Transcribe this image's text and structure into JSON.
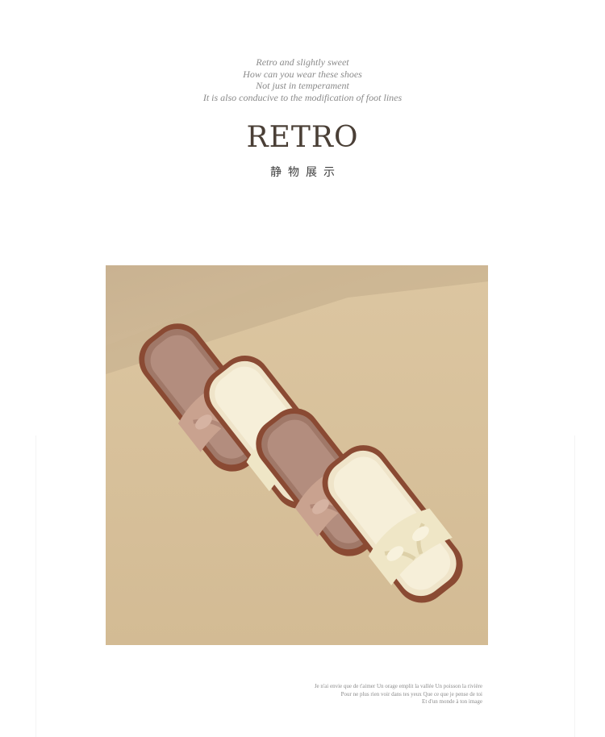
{
  "intro_lines": [
    "Retro and slightly sweet",
    "How can you wear these shoes",
    "Not just in temperament",
    "It is also conducive to the modification of foot lines"
  ],
  "title": "RETRO",
  "subtitle": "静物展示",
  "caption_lines": [
    "Je n'ai envie que de t'aimer Un orage emplit la vallée Un poisson la rivière",
    "Pour ne plus rien voir dans tes yeux Que ce que je pense de toi",
    "Et d'un monde à ton image"
  ],
  "colors": {
    "background": "#ffffff",
    "title": "#4a3f36",
    "photo_backdrop": "#d9c3a0",
    "sandal_pink": "#c9a28f",
    "sandal_cream": "#f1e9cf",
    "sole_brown": "#8a4a33"
  }
}
